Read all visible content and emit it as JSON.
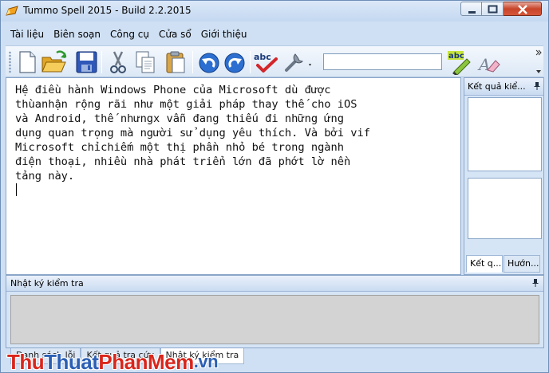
{
  "window": {
    "title": "Tummo Spell 2015 - Build 2.2.2015",
    "app_icon": "pencil-app-icon"
  },
  "menu": {
    "items": [
      {
        "label": "Tài liệu"
      },
      {
        "label": "Biên soạn"
      },
      {
        "label": "Công cụ"
      },
      {
        "label": "Cửa sổ"
      },
      {
        "label": "Giới thiệu"
      }
    ]
  },
  "toolbar": {
    "icons": [
      "new-document-icon",
      "open-folder-icon",
      "save-icon",
      "cut-icon",
      "copy-icon",
      "paste-icon",
      "undo-icon",
      "redo-icon",
      "spell-check-icon",
      "tools-icon",
      "highlight-abc-icon",
      "eraser-icon"
    ],
    "search_value": "",
    "spell_icon_text": "abc",
    "highlight_icon_text": "abc"
  },
  "editor": {
    "text": "Hệ điều hành Windows Phone của Microsoft dù được\nthùanhận rộng rãi như một giải pháp thay thế cho iOS\nvà Android, thế nhưngx vẫn đang thiếu đi những ứng\ndụng quan trọng mà người sử dụng yêu thích. Và bởi vif\nMicrosoft chỉchiếm một thị phần nhỏ bé trong ngành\nđiện thoại, nhiều nhà phát triển lớn đã phớt lờ nền\ntảng này."
  },
  "right_panel": {
    "title": "Kết quả kiể...",
    "tabs": [
      {
        "label": "Kết q...",
        "active": true
      },
      {
        "label": "Hướn...",
        "active": false
      }
    ]
  },
  "log_panel": {
    "title": "Nhật ký kiểm tra"
  },
  "bottom_tabs": [
    {
      "label": "Danh sách lỗi",
      "active": false
    },
    {
      "label": "Kết quả tra cứu",
      "active": false
    },
    {
      "label": "Nhật ký kiểm tra",
      "active": true
    }
  ],
  "watermark": {
    "part1": "Thu",
    "part2": "Thuat",
    "part3": "PhanMem",
    "part4": ".vn"
  },
  "colors": {
    "window_bg": "#cfe0f4",
    "close_button": "#c7452a",
    "watermark_red": "#d9261c",
    "watermark_blue": "#2b5fb5"
  }
}
